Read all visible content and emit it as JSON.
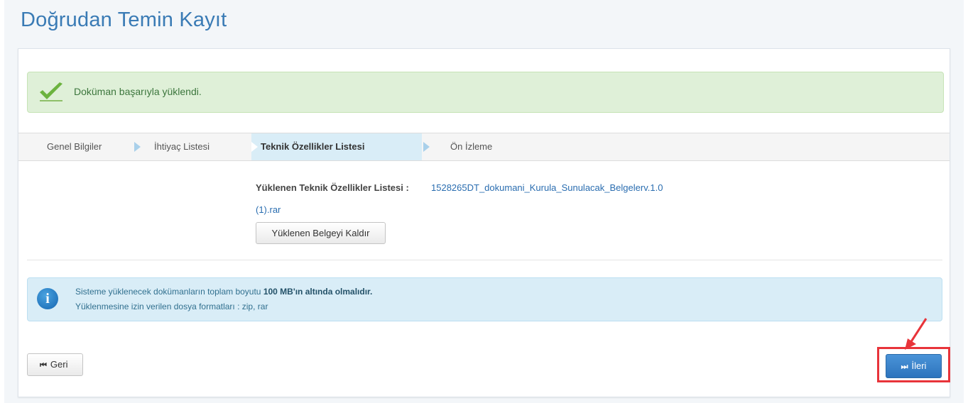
{
  "page": {
    "title": "Doğrudan Temin Kayıt"
  },
  "alert_success": {
    "message": "Doküman başarıyla yüklendi.",
    "icon": "check-icon"
  },
  "wizard": {
    "steps": [
      {
        "label": "Genel Bilgiler",
        "active": false
      },
      {
        "label": "İhtiyaç Listesi",
        "active": false
      },
      {
        "label": "Teknik Özellikler Listesi",
        "active": true
      },
      {
        "label": "Ön İzleme",
        "active": false
      }
    ]
  },
  "upload": {
    "label": "Yüklenen Teknik Özellikler Listesi :",
    "file_name_line1": "1528265DT_dokumani_Kurula_Sunulacak_Belgelerv.1.0",
    "file_name_line2": "(1).rar",
    "remove_button": "Yüklenen Belgeyi Kaldır"
  },
  "alert_info": {
    "line1_prefix": "Sisteme yüklenecek dokümanların toplam boyutu",
    "line1_bold": "100 MB'ın altında olmalıdır.",
    "line2": "Yüklenmesine izin verilen dosya formatları : zip, rar",
    "icon": "info-icon"
  },
  "nav": {
    "back_label": "Geri",
    "next_label": "İleri",
    "back_glyph": "⏮",
    "next_glyph": "⏭"
  },
  "colors": {
    "accent": "#3a7bb5",
    "success_bg": "#dff0d8",
    "info_bg": "#d9edf7",
    "annotation": "#e8343a"
  }
}
